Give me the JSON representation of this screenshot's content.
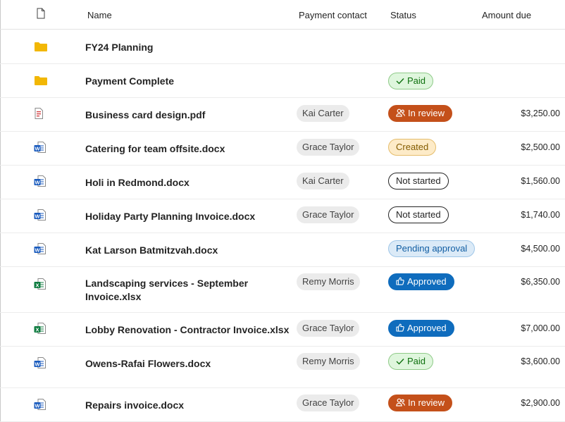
{
  "header": {
    "name": "Name",
    "payment_contact": "Payment contact",
    "status": "Status",
    "amount_due": "Amount due"
  },
  "rows": [
    {
      "type": "folder",
      "name": "FY24 Planning",
      "contact": "",
      "status": "",
      "status_kind": "",
      "amount": ""
    },
    {
      "type": "folder",
      "name": "Payment Complete",
      "contact": "",
      "status": "Paid",
      "status_kind": "paid",
      "amount": ""
    },
    {
      "type": "pdf",
      "name": "Business card design.pdf",
      "contact": "Kai Carter",
      "status": "In review",
      "status_kind": "review",
      "amount": "$3,250.00"
    },
    {
      "type": "word",
      "name": "Catering for team offsite.docx",
      "contact": "Grace Taylor",
      "status": "Created",
      "status_kind": "created",
      "amount": "$2,500.00"
    },
    {
      "type": "word",
      "name": "Holi in Redmond.docx",
      "contact": "Kai Carter",
      "status": "Not started",
      "status_kind": "notstarted",
      "amount": "$1,560.00"
    },
    {
      "type": "word",
      "name": "Holiday Party Planning Invoice.docx",
      "contact": "Grace Taylor",
      "status": "Not started",
      "status_kind": "notstarted",
      "amount": "$1,740.00"
    },
    {
      "type": "word",
      "name": "Kat Larson Batmitzvah.docx",
      "contact": "",
      "status": "Pending approval",
      "status_kind": "pending",
      "amount": "$4,500.00"
    },
    {
      "type": "excel",
      "name": "Landscaping services - September Invoice.xlsx",
      "contact": "Remy Morris",
      "status": "Approved",
      "status_kind": "approved",
      "amount": "$6,350.00"
    },
    {
      "type": "excel",
      "name": "Lobby Renovation - Contractor Invoice.xlsx",
      "contact": "Grace Taylor",
      "status": "Approved",
      "status_kind": "approved",
      "amount": "$7,000.00"
    },
    {
      "type": "word",
      "name": "Owens-Rafai Flowers.docx",
      "contact": "Remy Morris",
      "status": "Paid",
      "status_kind": "paid",
      "amount": "$3,600.00"
    },
    {
      "type": "word",
      "name": "Repairs invoice.docx",
      "contact": "Grace Taylor",
      "status": "In review",
      "status_kind": "review",
      "amount": "$2,900.00"
    }
  ],
  "colors": {
    "folder": "#f2b705",
    "word": "#185abd",
    "excel": "#107c41",
    "pdf": "#d13438",
    "review": "#c4501a",
    "approved": "#0f6cbd"
  }
}
